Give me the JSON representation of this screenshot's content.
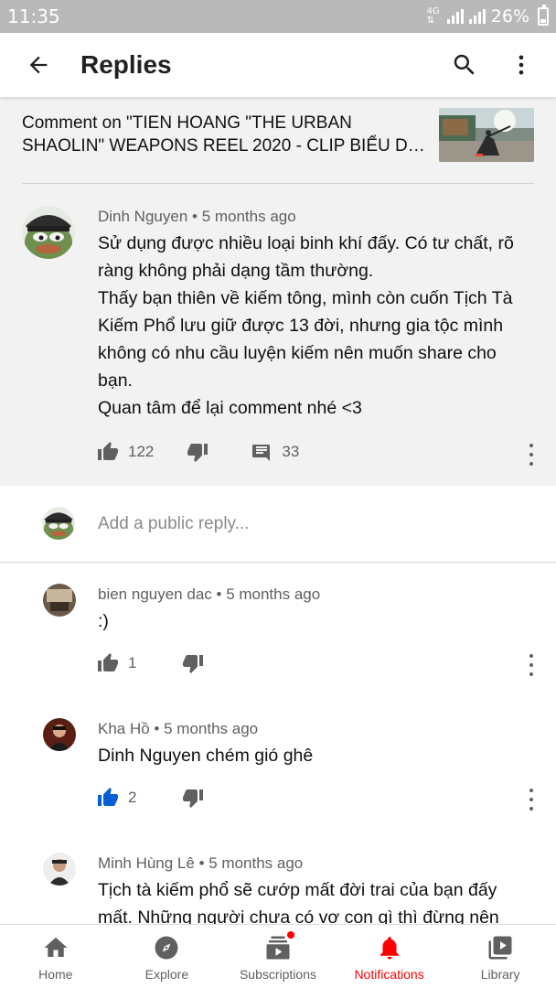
{
  "status_bar": {
    "time": "11:35",
    "network": "4G",
    "battery": "26%"
  },
  "app_bar": {
    "title": "Replies"
  },
  "video_context": {
    "text": "Comment on \"TIEN HOANG \"THE URBAN SHAOLIN\" WEAPONS REEL 2020 - CLIP BIỂU D…"
  },
  "parent_comment": {
    "author": "Dinh Nguyen",
    "age": "5 months ago",
    "lines": [
      "Sử dụng được nhiều loại binh khí đấy. Có tư chất, rõ",
      "ràng không phải dạng tầm thường.",
      "Thấy bạn thiên về kiếm tông, mình còn cuốn Tịch Tà",
      "Kiếm Phổ lưu giữ được 13 đời, nhưng gia tộc mình",
      "không có nhu cầu luyện kiếm nên muốn share cho",
      "bạn.",
      "Quan tâm để lại comment nhé <3"
    ],
    "likes": "122",
    "replies_count": "33"
  },
  "add_reply": {
    "placeholder": "Add a public reply..."
  },
  "replies": [
    {
      "author": "bien nguyen dac",
      "age": "5 months ago",
      "text": ":)",
      "likes": "1",
      "liked": false
    },
    {
      "author": "Kha Hồ",
      "age": "5 months ago",
      "text": "Dinh Nguyen chém gió ghê",
      "likes": "2",
      "liked": true
    },
    {
      "author": "Minh Hùng Lê",
      "age": "5 months ago",
      "lines": [
        "Tịch tà kiếm phổ sẽ cướp mất đời trai của bạn đấy",
        "mất. Những người chưa có vợ con gì thì đừng nên"
      ]
    }
  ],
  "bottom_nav": [
    {
      "label": "Home",
      "icon": "home-icon"
    },
    {
      "label": "Explore",
      "icon": "compass-icon"
    },
    {
      "label": "Subscriptions",
      "icon": "subscriptions-icon"
    },
    {
      "label": "Notifications",
      "icon": "bell-icon",
      "active": true
    },
    {
      "label": "Library",
      "icon": "library-icon"
    }
  ],
  "colors": {
    "accent": "#ff0000",
    "like_active": "#065fd4",
    "context_bg": "#f2f2f2",
    "status_bar": "#b9b9b9"
  }
}
